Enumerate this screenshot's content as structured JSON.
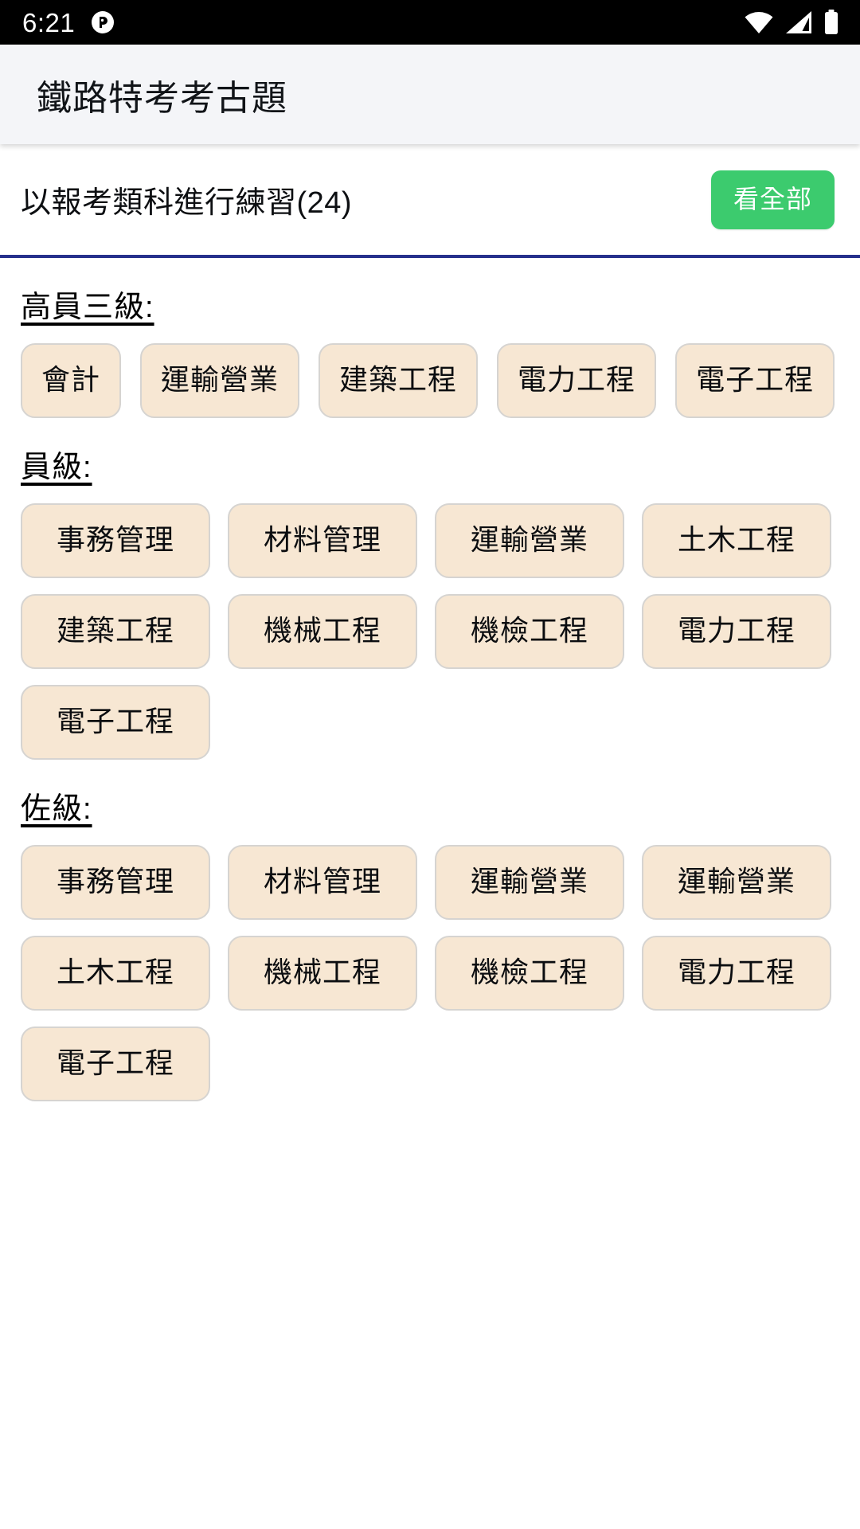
{
  "status_bar": {
    "clock": "6:21",
    "notification_icon": "app-notification-icon",
    "wifi_icon": "wifi-icon",
    "signal_icon": "cellular-signal-icon",
    "battery_icon": "battery-full-icon"
  },
  "app_bar": {
    "title": "鐵路特考考古題"
  },
  "sub_header": {
    "title": "以報考類科進行練習(24)",
    "view_all_label": "看全部",
    "accent_color": "#3ccb6e",
    "divider_color": "#26308c"
  },
  "theme": {
    "chip_background": "#f7e7d3",
    "chip_border": "#d6d4d1",
    "app_bar_background": "#f4f5f8",
    "page_background": "#ffffff",
    "text_color": "#000000"
  },
  "sections": [
    {
      "heading": "高員三級:",
      "layout": "flow",
      "chips": [
        "會計",
        "運輸營業",
        "建築工程",
        "電力工程",
        "電子工程"
      ]
    },
    {
      "heading": "員級:",
      "layout": "cols3",
      "chips": [
        "事務管理",
        "材料管理",
        "運輸營業",
        "土木工程",
        "建築工程",
        "機械工程",
        "機檢工程",
        "電力工程",
        "電子工程"
      ]
    },
    {
      "heading": "佐級:",
      "layout": "cols3",
      "chips": [
        "事務管理",
        "材料管理",
        "運輸營業",
        "運輸營業",
        "土木工程",
        "機械工程",
        "機檢工程",
        "電力工程",
        "電子工程"
      ]
    }
  ]
}
